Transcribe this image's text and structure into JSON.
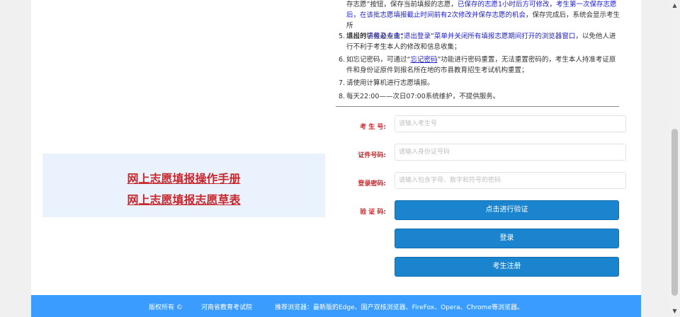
{
  "links": {
    "manual": "网上志愿填报操作手册",
    "draft": "网上志愿填报志愿草表"
  },
  "notes": {
    "n4_line1_a": "存志愿”按钮，保存当前填报的志愿，",
    "n4_line1_b": "已保存的志愿1小时后方可修改，考生第一次保存志愿",
    "n4_line2_a": "后，在该批志愿填报截止时间前有2次修改并保存志愿的机会",
    "n4_line2_b": "，保存完成后，系统会显示考生所",
    "n4_line3": "填报的学校及专业；",
    "n5_num": "5.",
    "n5_a": "退出时",
    "n5_b": "请务必点击“退出登录”菜单并关闭所有填报志愿期间打开的浏览器窗口",
    "n5_c": "，以免他人进",
    "n5_line2": "行不利于考生本人的修改和信息收集；",
    "n6_num": "6.",
    "n6_a": "如忘记密码，可通过“",
    "n6_link": "忘记密码",
    "n6_b": "”功能进行密码重置，无法重置密码的，考生本人持准考证原",
    "n6_line2": "件和身份证原件到报名所在地的市县教育招生考试机构重置；",
    "n7_num": "7.",
    "n7": "请使用计算机进行志愿填报。",
    "n8_num": "8.",
    "n8": "每天22:00——次日07:00系统维护，不提供服务。"
  },
  "form": {
    "exam_no_label": "考 生 号:",
    "exam_no_placeholder": "请输入考生号",
    "id_label": "证件号码:",
    "id_placeholder": "请输入身份证号码",
    "pwd_label": "登录密码:",
    "pwd_placeholder": "请输入包含字母、数字和符号的密码",
    "verify_label": "验 证 码:",
    "verify_button": "点击进行验证",
    "login_button": "登录",
    "register_button": "考生注册"
  },
  "footer": {
    "copyright": "版权所有 ©",
    "org": "河南省教育考试院",
    "browser": "推荐浏览器：最新版的Edge、国产双核浏览器、FireFox、Opera、Chrome等浏览器。"
  },
  "colors": {
    "accent_red": "#c8282d",
    "button_blue": "#1a84cf",
    "footer_blue": "#3a9cff",
    "link_box_bg": "#eaf3fd"
  }
}
